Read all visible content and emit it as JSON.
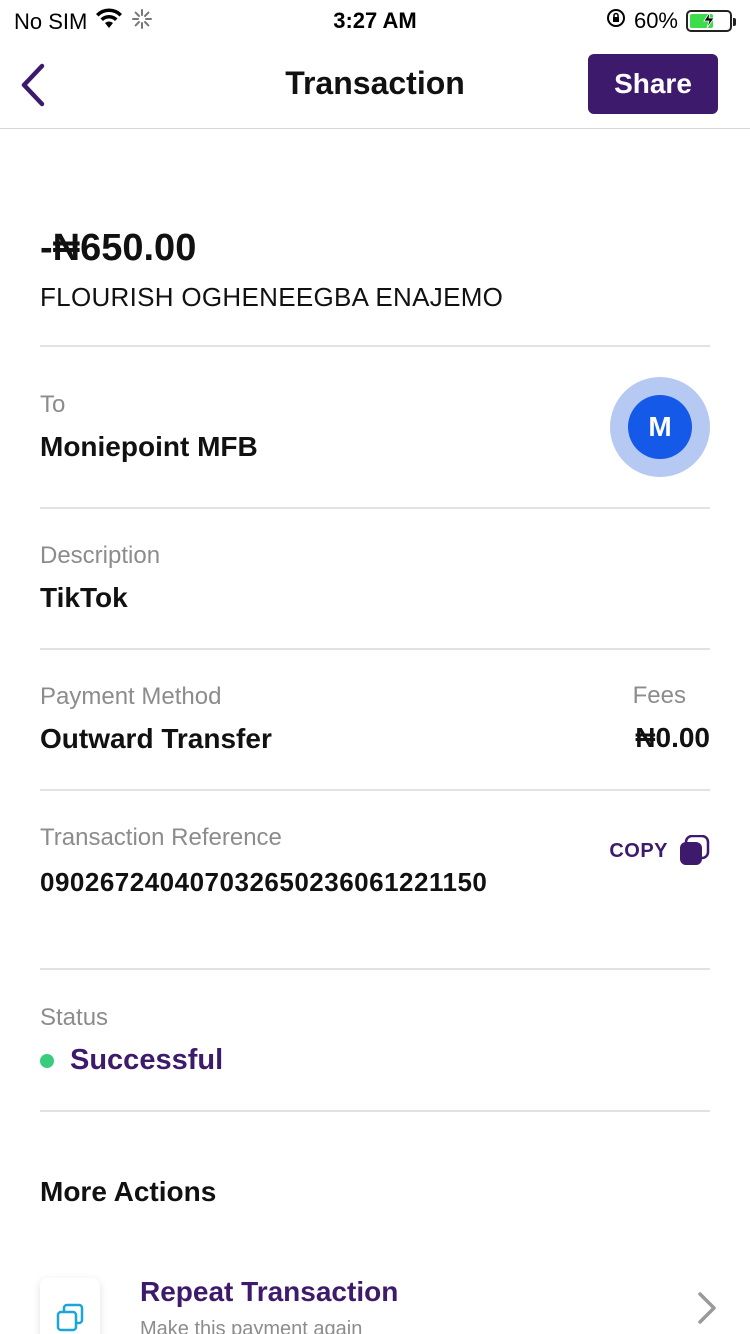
{
  "status_bar": {
    "carrier": "No SIM",
    "time": "3:27 AM",
    "battery_percent": "60%",
    "battery_level": 0.6
  },
  "nav": {
    "title": "Transaction",
    "share_label": "Share"
  },
  "summary": {
    "amount": "-₦650.00",
    "counterparty": "FLOURISH OGHENEEGBA ENAJEMO"
  },
  "to": {
    "label": "To",
    "value": "Moniepoint MFB",
    "avatar_letter": "M"
  },
  "description": {
    "label": "Description",
    "value": "TikTok"
  },
  "payment": {
    "method_label": "Payment Method",
    "method_value": "Outward Transfer",
    "fees_label": "Fees",
    "fees_value": "₦0.00"
  },
  "reference": {
    "label": "Transaction Reference",
    "value": "090267240407032650236061221150",
    "copy_label": "COPY"
  },
  "status": {
    "label": "Status",
    "value": "Successful"
  },
  "more_actions": {
    "title": "More Actions",
    "repeat_title": "Repeat Transaction",
    "repeat_subtitle": "Make this payment again"
  },
  "colors": {
    "brand_purple": "#3e1a6d",
    "success_green": "#39cc7e",
    "avatar_blue": "#1559e8"
  }
}
